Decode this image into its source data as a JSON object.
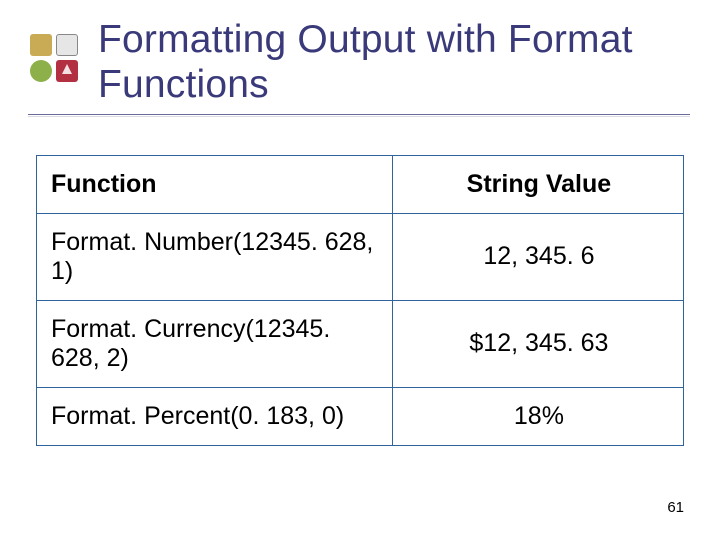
{
  "title": "Formatting Output with Format Functions",
  "table": {
    "headers": {
      "col1": "Function",
      "col2": "String Value"
    },
    "rows": [
      {
        "fn": "Format. Number(12345. 628, 1)",
        "val": "12, 345. 6"
      },
      {
        "fn": "Format. Currency(12345. 628, 2)",
        "val": "$12, 345. 63"
      },
      {
        "fn": "Format. Percent(0. 183, 0)",
        "val": "18%"
      }
    ]
  },
  "page_number": "61",
  "chart_data": {
    "type": "table",
    "title": "Formatting Output with Format Functions",
    "columns": [
      "Function",
      "String Value"
    ],
    "rows": [
      [
        "Format. Number(12345. 628, 1)",
        "12, 345. 6"
      ],
      [
        "Format. Currency(12345. 628, 2)",
        "$12, 345. 63"
      ],
      [
        "Format. Percent(0. 183, 0)",
        "18%"
      ]
    ]
  }
}
